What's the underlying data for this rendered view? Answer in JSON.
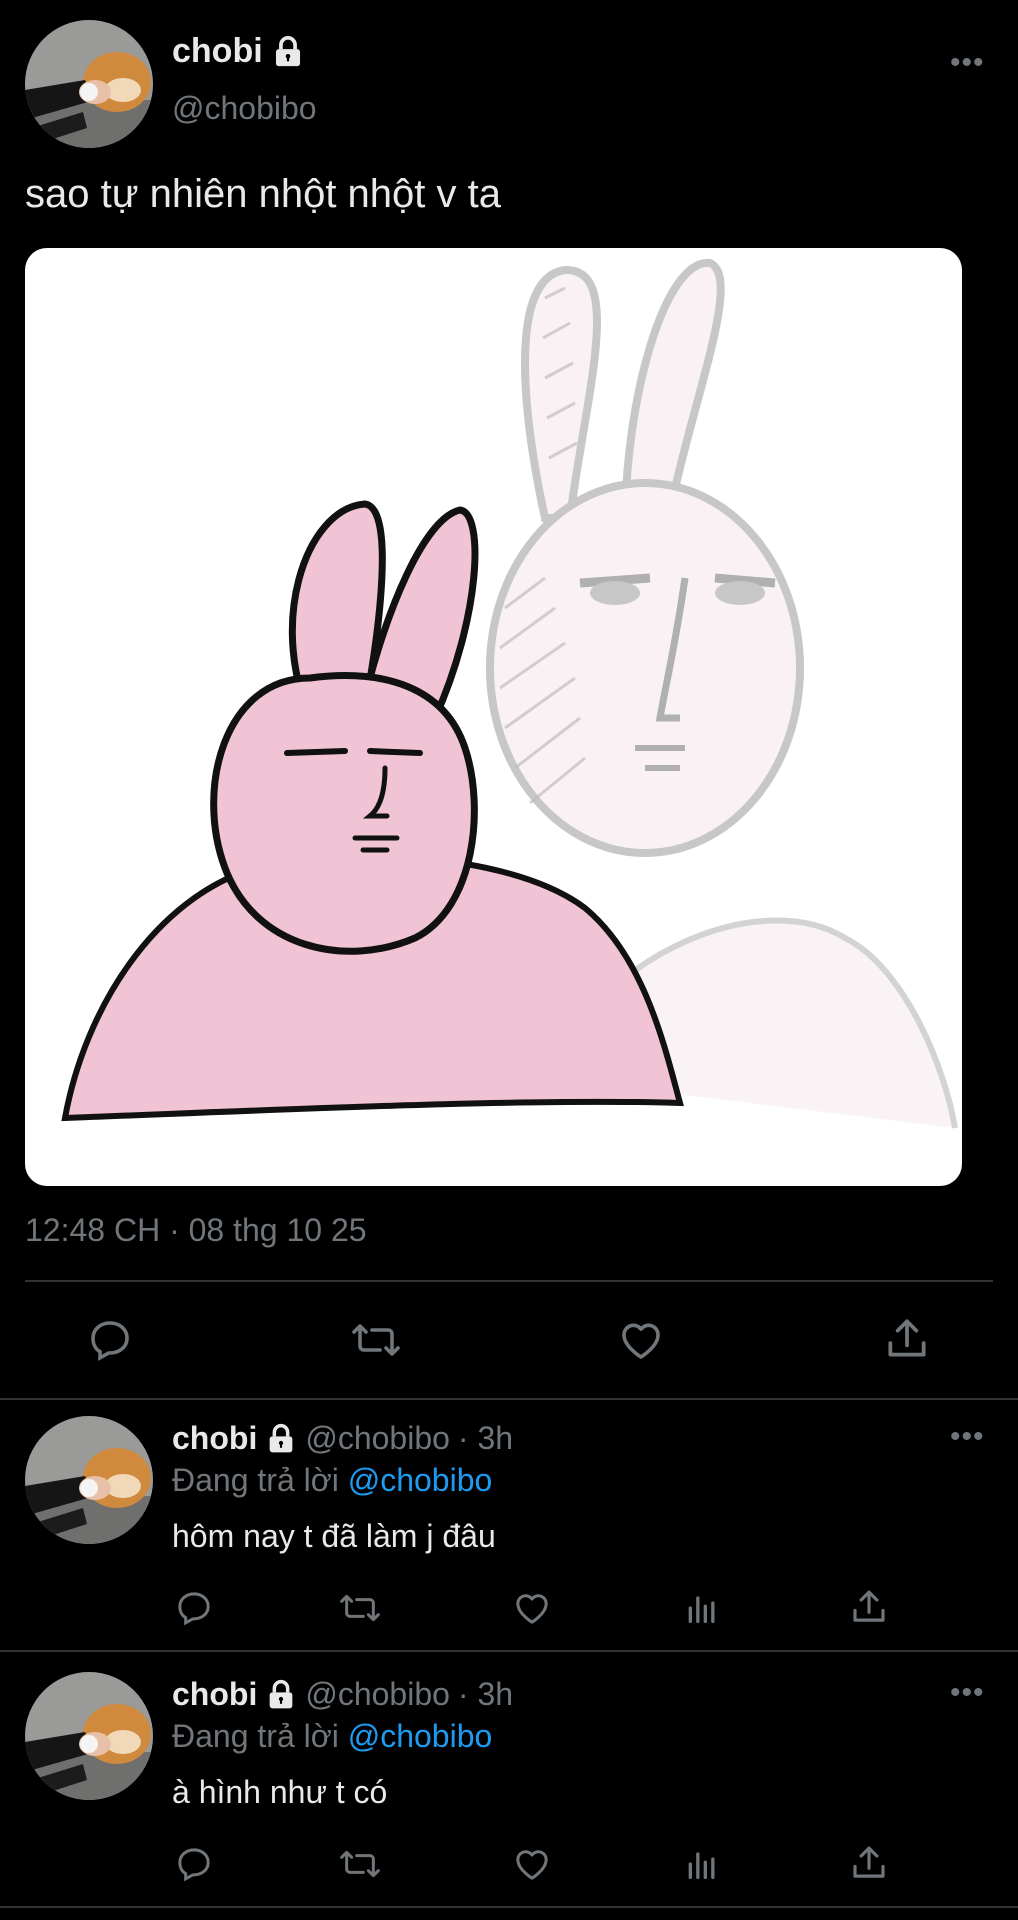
{
  "main_tweet": {
    "display_name": "chobi",
    "handle": "@chobibo",
    "more_label": "•••",
    "text": "sao tự nhiên nhột nhột v ta",
    "timestamp": "12:48 CH · 08 thg 10 25",
    "actions": [
      "reply-icon",
      "retweet-icon",
      "like-icon",
      "share-icon"
    ]
  },
  "replies": [
    {
      "display_name": "chobi",
      "handle": "@chobibo",
      "time": "· 3h",
      "replying_prefix": "Đang trả lời",
      "replying_to": "@chobibo",
      "text": "hôm nay t đã làm j đâu",
      "more_label": "•••"
    },
    {
      "display_name": "chobi",
      "handle": "@chobibo",
      "time": "· 3h",
      "replying_prefix": "Đang trả lời",
      "replying_to": "@chobibo",
      "text": "à hình như t có",
      "more_label": "•••"
    }
  ],
  "colors": {
    "background": "#000000",
    "text": "#e7e9ea",
    "secondary": "#71767b",
    "link": "#1d9bf0",
    "divider": "#2f3336",
    "bunny_pink": "#f0c4d4"
  }
}
